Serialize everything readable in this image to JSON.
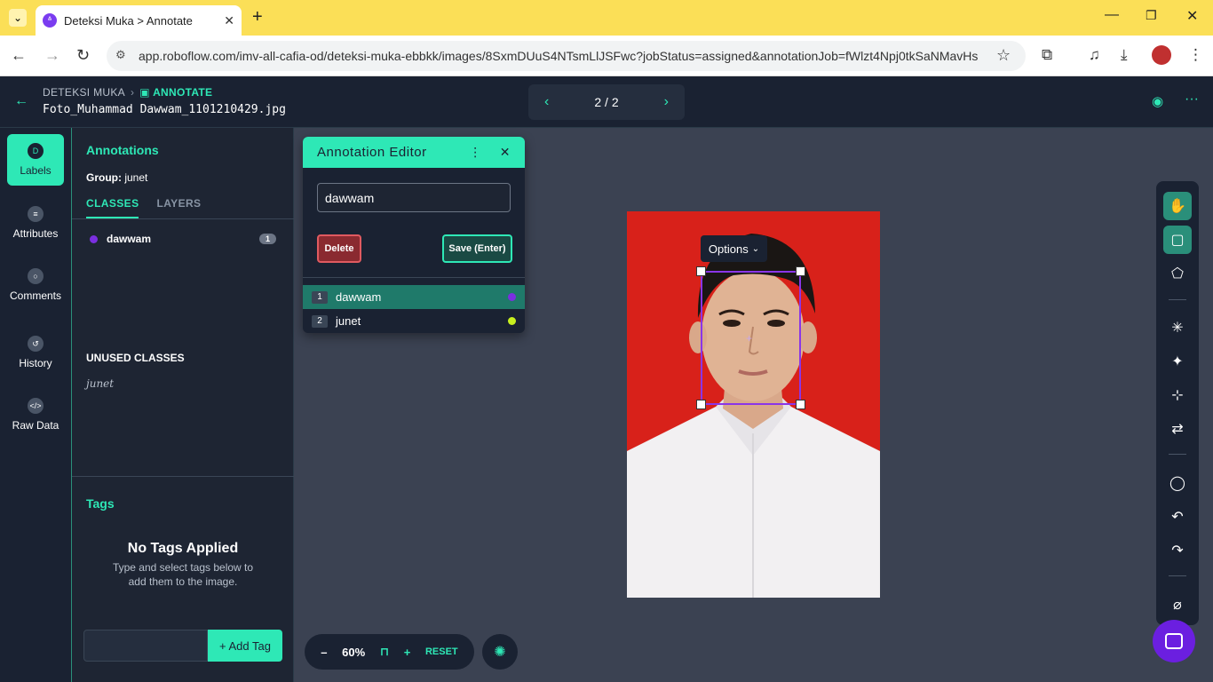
{
  "browser": {
    "tab_title": "Deteksi Muka > Annotate",
    "url": "app.roboflow.com/imv-all-cafia-od/deteksi-muka-ebbkk/images/8SxmDUuS4NTsmLlJSFwc?jobStatus=assigned&annotationJob=fWlzt4Npj0tkSaNMavHs"
  },
  "header": {
    "project": "DETEKSI MUKA",
    "section": "ANNOTATE",
    "filename": "Foto_Muhammad Dawwam_1101210429.jpg",
    "pager": "2 / 2"
  },
  "rail": [
    {
      "label": "Labels",
      "icon": "D"
    },
    {
      "label": "Attributes",
      "icon": "≡"
    },
    {
      "label": "Comments",
      "icon": "○"
    },
    {
      "label": "History",
      "icon": "↺"
    },
    {
      "label": "Raw Data",
      "icon": "</>"
    }
  ],
  "panel": {
    "title": "Annotations",
    "group_label": "Group:",
    "group_value": "junet",
    "tab_classes": "CLASSES",
    "tab_layers": "LAYERS",
    "classes": [
      {
        "name": "dawwam",
        "count": "1",
        "color": "#7b2fe0"
      }
    ],
    "unused_title": "UNUSED CLASSES",
    "unused": [
      "junet"
    ],
    "tags_title": "Tags",
    "no_tags": "No Tags Applied",
    "no_tags_sub": "Type and select tags below to add them to the image.",
    "add_tag": "+ Add Tag"
  },
  "editor": {
    "title": "Annotation Editor",
    "value": "dawwam",
    "delete": "Delete",
    "save": "Save (Enter)",
    "rows": [
      {
        "num": "1",
        "name": "dawwam",
        "color": "#7b2fe0"
      },
      {
        "num": "2",
        "name": "junet",
        "color": "#c8f01e"
      }
    ]
  },
  "canvas": {
    "options_label": "Options",
    "box_color": "#8a35e8"
  },
  "zoom": {
    "minus": "–",
    "value": "60%",
    "plus": "+",
    "reset": "RESET"
  }
}
